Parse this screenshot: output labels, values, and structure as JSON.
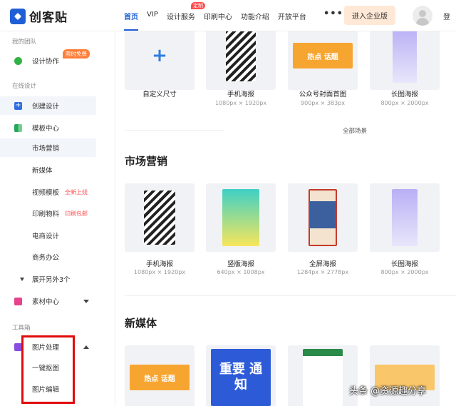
{
  "header": {
    "logo_text": "创客贴",
    "nav": [
      "首页",
      "VIP",
      "设计服务",
      "印刷中心",
      "功能介绍",
      "开放平台"
    ],
    "nav_badge": "定制",
    "more": "•••",
    "enterprise_button": "进入企业版",
    "login": "登"
  },
  "sidebar": {
    "team_section": "我的团队",
    "design_collab": "设计协作",
    "free_badge": "限时免费",
    "online_section": "在线设计",
    "create_design": "创建设计",
    "template_center": "模板中心",
    "templates": [
      {
        "label": "市场营销",
        "tag": ""
      },
      {
        "label": "新媒体",
        "tag": ""
      },
      {
        "label": "视频模板",
        "tag": "全新上线"
      },
      {
        "label": "印刷物料",
        "tag": "印刷包邮"
      },
      {
        "label": "电商设计",
        "tag": ""
      },
      {
        "label": "商务办公",
        "tag": ""
      }
    ],
    "expand_more": "展开另外3个",
    "material_center": "素材中心",
    "tools_section": "工具箱",
    "image_processing": "图片处理",
    "cutout": "一键抠图",
    "image_edit": "图片编辑"
  },
  "main": {
    "top_cards": [
      {
        "name": "自定义尺寸",
        "size": ""
      },
      {
        "name": "手机海报",
        "size": "1080px × 1920px"
      },
      {
        "name": "公众号封面首图",
        "size": "900px × 383px"
      },
      {
        "name": "长图海报",
        "size": "800px × 2000px"
      }
    ],
    "all_scenes": "全部场景",
    "marketing_title": "市场营销",
    "marketing_cards": [
      {
        "name": "手机海报",
        "size": "1080px × 1920px"
      },
      {
        "name": "竖版海报",
        "size": "640px × 1008px"
      },
      {
        "name": "全屏海报",
        "size": "1284px × 2778px"
      },
      {
        "name": "长图海报",
        "size": "800px × 2000px"
      }
    ],
    "newmedia_title": "新媒体",
    "poster_texts": {
      "hot_topic": "热点 话题",
      "important_notice": "重要 通知"
    }
  },
  "watermark": "头条 @资源趣分享",
  "colors": {
    "brand": "#1f5fd6",
    "accent_red": "#ff4d4f",
    "enterprise_bg": "#ffe8d6"
  }
}
